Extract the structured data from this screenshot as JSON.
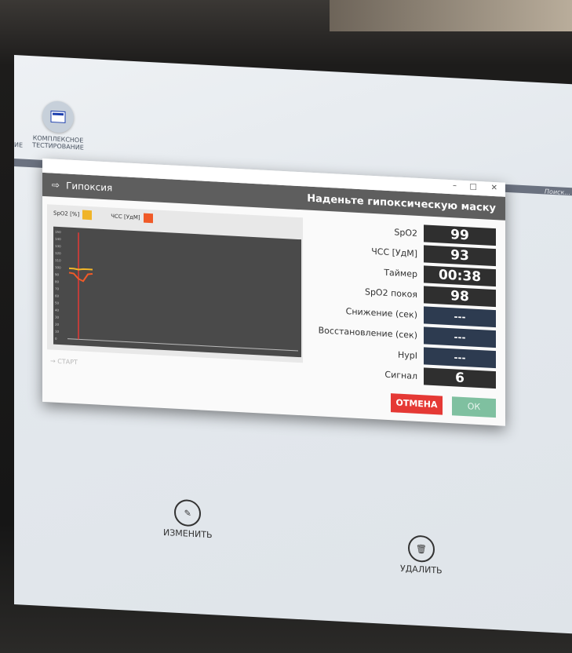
{
  "desktop": {
    "partial_label": "ИЕ",
    "complex_test_label_1": "КОМПЛЕКСНОЕ",
    "complex_test_label_2": "ТЕСТИРОВАНИЕ",
    "search_placeholder": "Поиск..."
  },
  "dialog": {
    "title": "Гипоксия",
    "instruction": "Наденьте гипоксическую маску",
    "legend_spo2": "SpO2 [%]",
    "legend_hr": "ЧСС [УдМ]",
    "start": "→ СТАРТ",
    "rows": [
      {
        "label": "SpO2",
        "value": "99"
      },
      {
        "label": "ЧСС [УдМ]",
        "value": "93"
      },
      {
        "label": "Таймер",
        "value": "00:38"
      },
      {
        "label": "SpO2 покоя",
        "value": "98"
      },
      {
        "label": "Снижение (сек)",
        "value": "---"
      },
      {
        "label": "Восстановление (сек)",
        "value": "---"
      },
      {
        "label": "HypI",
        "value": "---"
      },
      {
        "label": "Сигнал",
        "value": "6"
      }
    ],
    "cancel": "ОТМЕНА",
    "ok": "ОК"
  },
  "actions": {
    "edit": "ИЗМЕНИТЬ",
    "delete": "УДАЛИТЬ"
  },
  "colors": {
    "spo2": "#f0b429",
    "hr": "#f05a28",
    "cursor": "#e53935"
  },
  "chart_data": {
    "type": "line",
    "y_ticks": [
      "150",
      "140",
      "130",
      "120",
      "110",
      "100",
      "90",
      "80",
      "70",
      "60",
      "50",
      "40",
      "30",
      "20",
      "10",
      "0"
    ],
    "ylim": [
      0,
      150
    ],
    "series": [
      {
        "name": "SpO2 [%]",
        "values": [
          99,
          99,
          98,
          99,
          99,
          99
        ]
      },
      {
        "name": "ЧСС [УдМ]",
        "values": [
          93,
          92,
          85,
          82,
          92,
          93
        ]
      }
    ]
  }
}
